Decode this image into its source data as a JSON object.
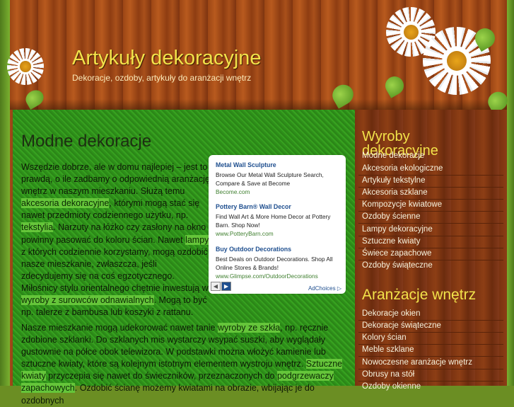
{
  "header": {
    "title": "Artykuły dekoracyjne",
    "description": "Dekoracje, ozdoby, artykuły do aranżacji wnętrz"
  },
  "main": {
    "title": "Modne dekoracje",
    "para1": {
      "t1": "Wszędzie dobrze, ale w domu najlepiej – jest to prawdą, o ile zadbamy o odpowiednią aranżację wnętrz w naszym mieszkaniu. Służą temu ",
      "l1": "akcesoria dekoracyjne",
      "t2": ", którymi mogą stać się nawet przedmioty codziennego użytku, np. ",
      "l2": "tekstylia",
      "t3": ". Narzuty na łóżko czy zasłony na okno powinny pasować do koloru ścian. Nawet ",
      "l3": "lampy",
      "t4": ", z których codziennie korzystamy, mogą ozdobić nasze mieszkanie, zwłaszcza, jeśli zdecydujemy się na coś egzotycznego. Miłośnicy stylu orientalnego chętnie inwestują w ",
      "l4": "wyroby z surowców odnawialnych",
      "t5": ". Mogą to być np. talerze z bambusa lub koszyki z rattanu."
    },
    "para2": {
      "t1": "Nasze mieszkanie mogą udekorować nawet tanie ",
      "l1": "wyroby ze szkła",
      "t2": ", np. ręcznie zdobione szklanki. Do szklanych mis wystarczy wsypać suszki, aby wyglądały gustownie na półce obok telewizora. W podstawki można włożyć kamienie lub sztuczne kwiaty, które są kolejnym istotnym elementem wystroju wnętrz. ",
      "l2": "Sztuczne kwiaty",
      "t3": " przyczepia się nawet do świeczników, przeznaczonych do ",
      "l3": "podgrzewaczy zapachowych",
      "t4": ". Ozdobić ścianę możemy kwiatami na obrazie, wbijając je do ozdobnych"
    }
  },
  "ads": {
    "items": [
      {
        "title": "Metal Wall Sculpture",
        "text": "Browse Our Metal Wall Sculpture Search, Compare & Save at Become",
        "url": "Become.com"
      },
      {
        "title": "Pottery Barn® Wall Decor",
        "text": "Find Wall Art & More Home Decor at Pottery Barn. Shop Now!",
        "url": "www.PotteryBarn.com"
      },
      {
        "title": "Buy Outdoor Decorations",
        "text": "Best Deals on Outdoor Decorations. Shop All Online Stores & Brands!",
        "url": "www.Glimpse.com/OutdoorDecorations"
      }
    ],
    "prev": "◀",
    "next": "▶",
    "adchoices": "AdChoices ▷"
  },
  "sidebar": {
    "section1": {
      "title": "Wyroby dekoracyjne",
      "items": [
        "Modne dekoracje",
        "Akcesoria ekologiczne",
        "Artykuły tekstylne",
        "Akcesoria szklane",
        "Kompozycje kwiatowe",
        "Ozdoby ścienne",
        "Lampy dekoracyjne",
        "Sztuczne kwiaty",
        "Świece zapachowe",
        "Ozdoby świąteczne"
      ]
    },
    "section2": {
      "title": "Aranżacje wnętrz",
      "items": [
        "Dekoracje okien",
        "Dekoracje świąteczne",
        "Kolory ścian",
        "Meble szklane",
        "Nowoczesne aranżacje wnętrz",
        "Obrusy na stół",
        "Ozdoby okienne"
      ]
    }
  }
}
